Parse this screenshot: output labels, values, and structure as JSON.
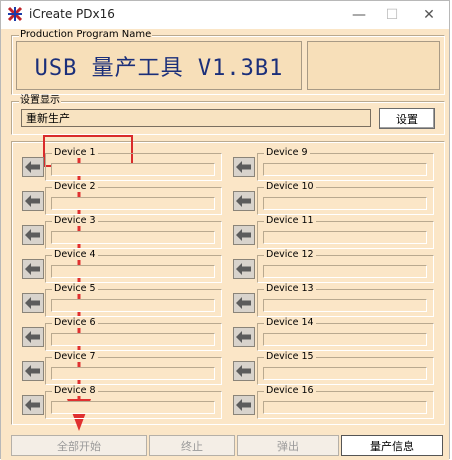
{
  "window": {
    "title": "iCreate PDx16",
    "minimize_glyph": "—",
    "maximize_glyph": "☐",
    "close_glyph": "✕"
  },
  "production": {
    "label": "Production Program Name",
    "name": "USB 量产工具 V1.3B1"
  },
  "config": {
    "label": "设置显示",
    "value": "重新生产",
    "button": "设置"
  },
  "devices": {
    "left": [
      "Device 1",
      "Device 2",
      "Device 3",
      "Device 4",
      "Device 5",
      "Device 6",
      "Device 7",
      "Device 8"
    ],
    "right": [
      "Device 9",
      "Device 10",
      "Device 11",
      "Device 12",
      "Device 13",
      "Device 14",
      "Device 15",
      "Device 16"
    ]
  },
  "buttons": {
    "start_all": "全部开始",
    "stop": "终止",
    "eject": "弹出",
    "info": "量产信息"
  },
  "colors": {
    "background": "#fbe6c7",
    "title_text": "#1b2f7a",
    "highlight_box": "#d92b2b"
  }
}
